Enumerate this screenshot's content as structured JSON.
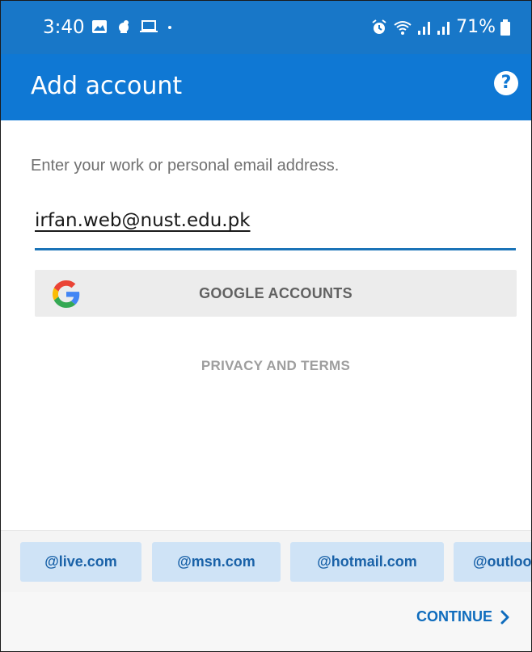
{
  "status_bar": {
    "time": "3:40",
    "battery": "71%",
    "left_icons": [
      "gallery-icon",
      "notification-icon",
      "laptop-icon",
      "dot-icon"
    ],
    "right_icons": [
      "alarm-icon",
      "wifi-icon",
      "signal-icon",
      "signal-icon",
      "battery-icon"
    ]
  },
  "app_bar": {
    "title": "Add account",
    "help_label": "?"
  },
  "form": {
    "prompt": "Enter your work or personal email address.",
    "email_value": "irfan.web@nust.edu.pk",
    "google_button_label": "GOOGLE ACCOUNTS",
    "privacy_link": "PRIVACY AND TERMS"
  },
  "domain_chips": [
    "@live.com",
    "@msn.com",
    "@hotmail.com",
    "@outlook.com"
  ],
  "footer": {
    "continue_label": "CONTINUE"
  },
  "colors": {
    "status_bar": "#1877c8",
    "app_bar": "#0f78d4",
    "accent": "#0f6cbd",
    "chip_bg": "#cfe3f6"
  }
}
